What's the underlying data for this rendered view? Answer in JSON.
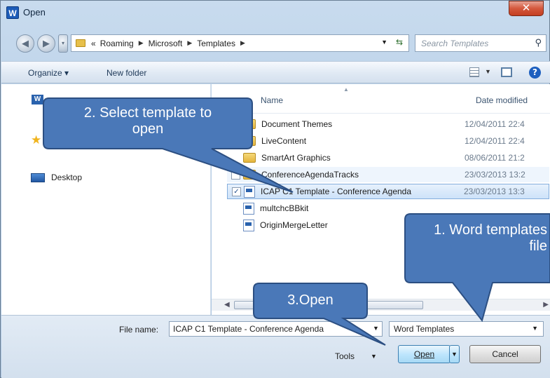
{
  "window": {
    "title": "Open",
    "app_icon_letter": "W",
    "close_glyph": "✕"
  },
  "address_bar": {
    "prefix": "«",
    "crumbs": [
      "Roaming",
      "Microsoft",
      "Templates"
    ],
    "separator": "▶",
    "search_placeholder": "Search Templates"
  },
  "command_bar": {
    "organize": "Organize ▾",
    "new_folder": "New folder"
  },
  "nav_pane": {
    "top_label": "W",
    "desktop": "Desktop"
  },
  "file_list": {
    "col_name": "Name",
    "col_date": "Date modified",
    "rows": [
      {
        "name": "Document Themes",
        "date": "12/04/2011 22:4",
        "type": "folder",
        "checked": false
      },
      {
        "name": "LiveContent",
        "date": "12/04/2011 22:4",
        "type": "folder",
        "checked": false
      },
      {
        "name": "SmartArt Graphics",
        "date": "08/06/2011 21:2",
        "type": "folder",
        "checked": false
      },
      {
        "name": "ConferenceAgendaTracks",
        "date": "23/03/2013 13:2",
        "type": "folder",
        "checked": false
      },
      {
        "name": "ICAP C1 Template - Conference Agenda",
        "date": "23/03/2013 13:3",
        "type": "doc",
        "checked": true
      },
      {
        "name": "multchcBBkit",
        "date": "",
        "type": "doc",
        "checked": false
      },
      {
        "name": "OriginMergeLetter",
        "date": "",
        "type": "doc",
        "checked": false
      }
    ]
  },
  "bottom": {
    "file_name_label": "File name:",
    "file_name_value": "ICAP C1 Template - Conference Agenda",
    "file_type_value": "Word Templates",
    "tools_label": "Tools",
    "open_label": "Open",
    "cancel_label": "Cancel"
  },
  "callouts": {
    "c1": "1. Word templates file",
    "c2_line1": "2. Select template to",
    "c2_line2": "open",
    "c3": "3.Open",
    "fill": "#4a78b8",
    "stroke": "#2c4f82"
  },
  "colors": {
    "titlebar": "#c8dbee",
    "close_red": "#d4583d",
    "selection": "#cde2f9"
  }
}
